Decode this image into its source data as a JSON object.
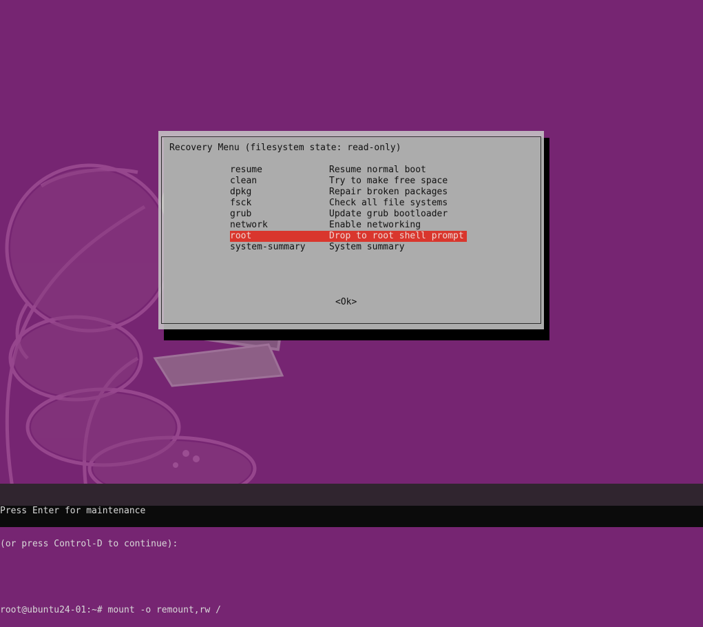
{
  "dialog": {
    "title": "Recovery Menu (filesystem state: read-only)",
    "selected_index": 6,
    "items": [
      {
        "command": "resume",
        "description": "Resume normal boot"
      },
      {
        "command": "clean",
        "description": "Try to make free space"
      },
      {
        "command": "dpkg",
        "description": "Repair broken packages"
      },
      {
        "command": "fsck",
        "description": "Check all file systems"
      },
      {
        "command": "grub",
        "description": "Update grub bootloader"
      },
      {
        "command": "network",
        "description": "Enable networking"
      },
      {
        "command": "root",
        "description": "Drop to root shell prompt"
      },
      {
        "command": "system-summary",
        "description": "System summary"
      }
    ],
    "ok_label": "<Ok>"
  },
  "console": {
    "lines": [
      "Press Enter for maintenance",
      "(or press Control-D to continue):",
      "",
      "root@ubuntu24-01:~# mount -o remount,rw /"
    ]
  },
  "colors": {
    "background": "#762572",
    "selection": "#d9362d",
    "dialog": "#c8c8c8"
  }
}
